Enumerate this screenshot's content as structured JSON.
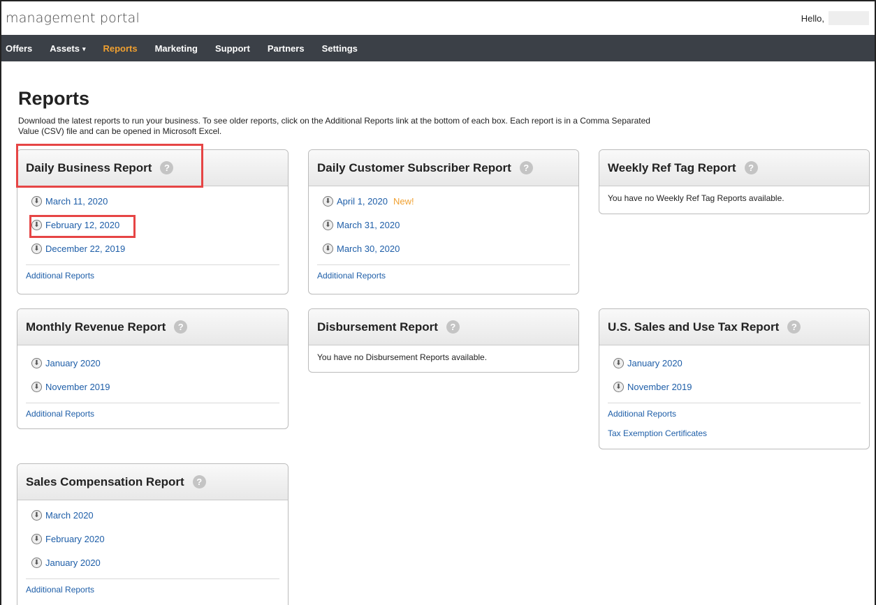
{
  "header": {
    "brand": "management portal",
    "greeting": "Hello,"
  },
  "nav": {
    "items": [
      {
        "label": "Offers"
      },
      {
        "label": "Assets",
        "caret": "▾"
      },
      {
        "label": "Reports"
      },
      {
        "label": "Marketing"
      },
      {
        "label": "Support"
      },
      {
        "label": "Partners"
      },
      {
        "label": "Settings"
      }
    ],
    "active": "Reports",
    "accent_color": "#f0a030"
  },
  "page": {
    "title": "Reports",
    "intro": "Download the latest reports to run your business. To see older reports, click on the Additional Reports link at the bottom of each box. Each report is in a Comma Separated Value (CSV) file and can be opened in Microsoft Excel."
  },
  "cards": [
    {
      "title": "Daily Business Report",
      "help": "?",
      "items": [
        {
          "label": "March 11, 2020"
        },
        {
          "label": "February 12, 2020"
        },
        {
          "label": "December 22, 2019"
        }
      ],
      "additional": "Additional Reports"
    },
    {
      "title": "Daily Customer Subscriber Report",
      "help": "?",
      "items": [
        {
          "label": "April 1, 2020",
          "badge": "New!"
        },
        {
          "label": "March 31, 2020"
        },
        {
          "label": "March 30, 2020"
        }
      ],
      "additional": "Additional Reports"
    },
    {
      "title": "Weekly Ref Tag Report",
      "help": "?",
      "empty": "You have no Weekly Ref Tag Reports available."
    },
    {
      "title": "Monthly Revenue Report",
      "help": "?",
      "items": [
        {
          "label": "January 2020"
        },
        {
          "label": "November 2019"
        }
      ],
      "additional": "Additional Reports"
    },
    {
      "title": "Disbursement Report",
      "help": "?",
      "empty": "You have no Disbursement Reports available."
    },
    {
      "title": "U.S. Sales and Use Tax Report",
      "help": "?",
      "items": [
        {
          "label": "January 2020"
        },
        {
          "label": "November 2019"
        }
      ],
      "additional": "Additional Reports",
      "extra_link": "Tax Exemption Certificates"
    },
    {
      "title": "Sales Compensation Report",
      "help": "?",
      "items": [
        {
          "label": "March 2020"
        },
        {
          "label": "February 2020"
        },
        {
          "label": "January 2020"
        }
      ],
      "additional": "Additional Reports"
    }
  ],
  "download_icon": "download-circle-icon",
  "help_icon": "question-circle-icon"
}
